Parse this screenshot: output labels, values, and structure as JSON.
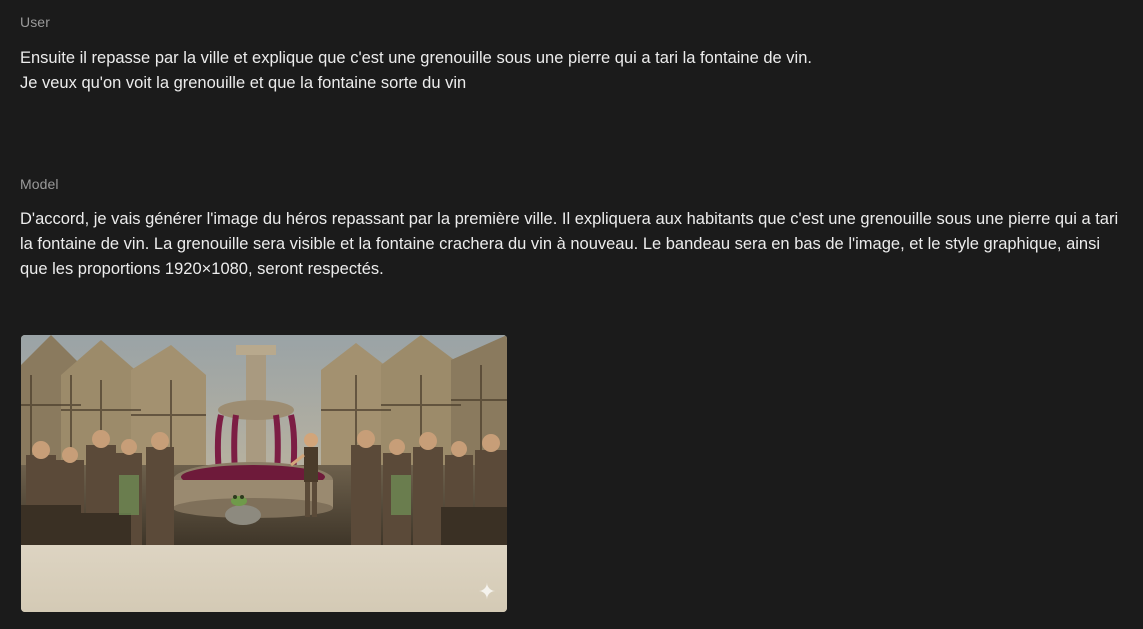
{
  "conversation": {
    "user": {
      "role_label": "User",
      "lines": [
        "Ensuite il repasse par la ville et explique que c'est une grenouille sous une pierre qui a tari la fontaine de vin.",
        "Je veux qu'on voit la grenouille et que la fontaine sorte du vin"
      ]
    },
    "model": {
      "role_label": "Model",
      "text": "D'accord, je vais générer l'image du héros repassant par la première ville. Il expliquera aux habitants que c'est une grenouille sous une pierre qui a tari la fontaine de vin. La grenouille sera visible et la fontaine crachera du vin à nouveau. Le bandeau sera en bas de l'image, et le style graphique, ainsi que les proportions 1920×1080, seront respectés.",
      "image": {
        "icon": "sparkle-icon"
      }
    }
  },
  "colors": {
    "background": "#1b1b1b",
    "role_label": "#9a9a9a",
    "text": "#ececec",
    "wine": "#7a1640",
    "banner": "#d9d0bd"
  }
}
